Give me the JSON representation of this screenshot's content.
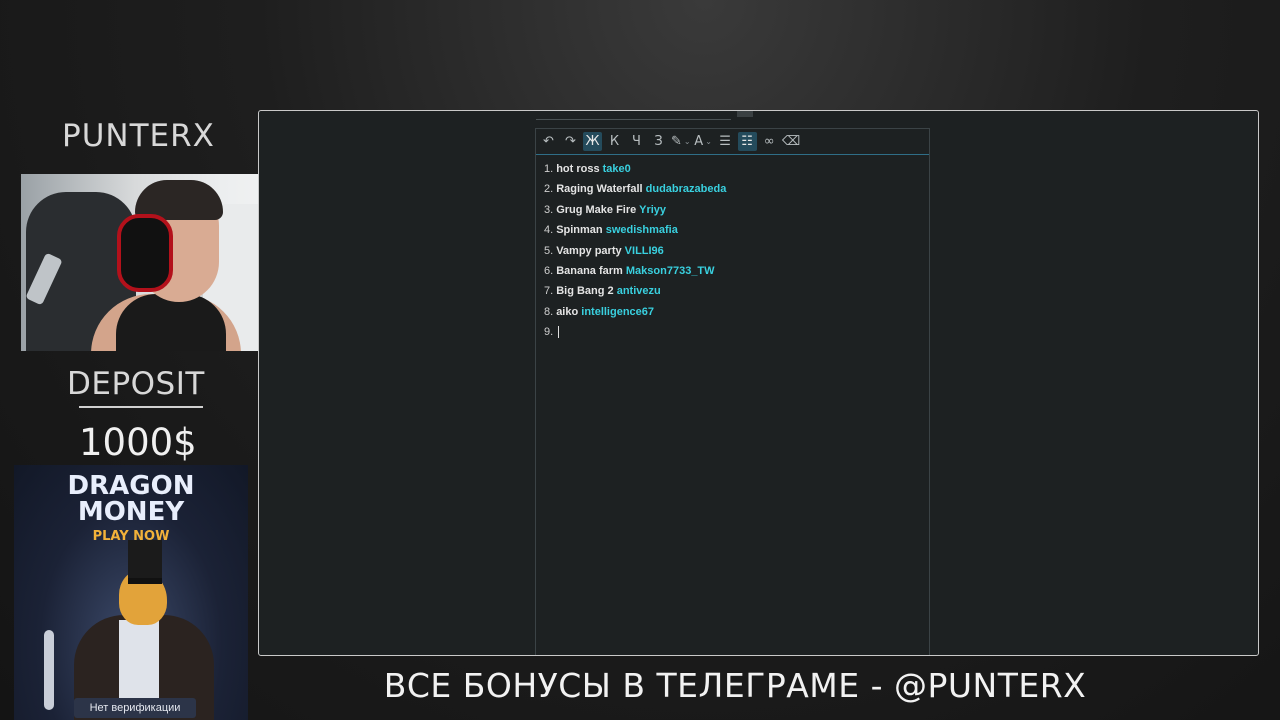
{
  "overlay": {
    "brand": "PUNTERX",
    "deposit_label": "DEPOSIT",
    "deposit_amount": "1000$",
    "ad": {
      "title_line1": "DRAGON",
      "title_line2": "MONEY",
      "cta": "PLAY NOW",
      "badge": "Нет верификации"
    },
    "footer": "ВСЕ БОНУСЫ В ТЕЛЕГРАМЕ - @PUNTERX"
  },
  "editor": {
    "toolbar": [
      {
        "name": "undo-icon",
        "glyph": "↶",
        "active": false
      },
      {
        "name": "redo-icon",
        "glyph": "↷",
        "active": false
      },
      {
        "name": "bold-button",
        "glyph": "Ж",
        "active": true
      },
      {
        "name": "italic-button",
        "glyph": "К",
        "active": false
      },
      {
        "name": "underline-button",
        "glyph": "Ч",
        "active": false
      },
      {
        "name": "strikethrough-button",
        "glyph": "З",
        "active": false
      },
      {
        "name": "highlight-pen-icon",
        "glyph": "✎",
        "active": false,
        "dropdown": true
      },
      {
        "name": "text-color-icon",
        "glyph": "A",
        "active": false,
        "dropdown": true
      },
      {
        "name": "bullet-list-icon",
        "glyph": "☰",
        "active": false
      },
      {
        "name": "numbered-list-icon",
        "glyph": "☷",
        "active": true
      },
      {
        "name": "link-icon",
        "glyph": "∞",
        "active": false
      },
      {
        "name": "eraser-icon",
        "glyph": "⌫",
        "active": false
      }
    ],
    "items": [
      {
        "num": "1.",
        "game": "hot ross",
        "user": "take0"
      },
      {
        "num": "2.",
        "game": "Raging Waterfall",
        "user": "dudabrazabeda"
      },
      {
        "num": "3.",
        "game": "Grug Make Fire",
        "user": "Yriyy"
      },
      {
        "num": "4.",
        "game": "Spinman",
        "user": "swedishmafia"
      },
      {
        "num": "5.",
        "game": "Vampy party",
        "user": "VILLI96"
      },
      {
        "num": "6.",
        "game": "Banana farm",
        "user": "Makson7733_TW"
      },
      {
        "num": "7.",
        "game": "Big Bang 2",
        "user": "antivezu"
      },
      {
        "num": "8.",
        "game": "aiko",
        "user": "intelligence67"
      },
      {
        "num": "9.",
        "game": "",
        "user": ""
      }
    ]
  }
}
